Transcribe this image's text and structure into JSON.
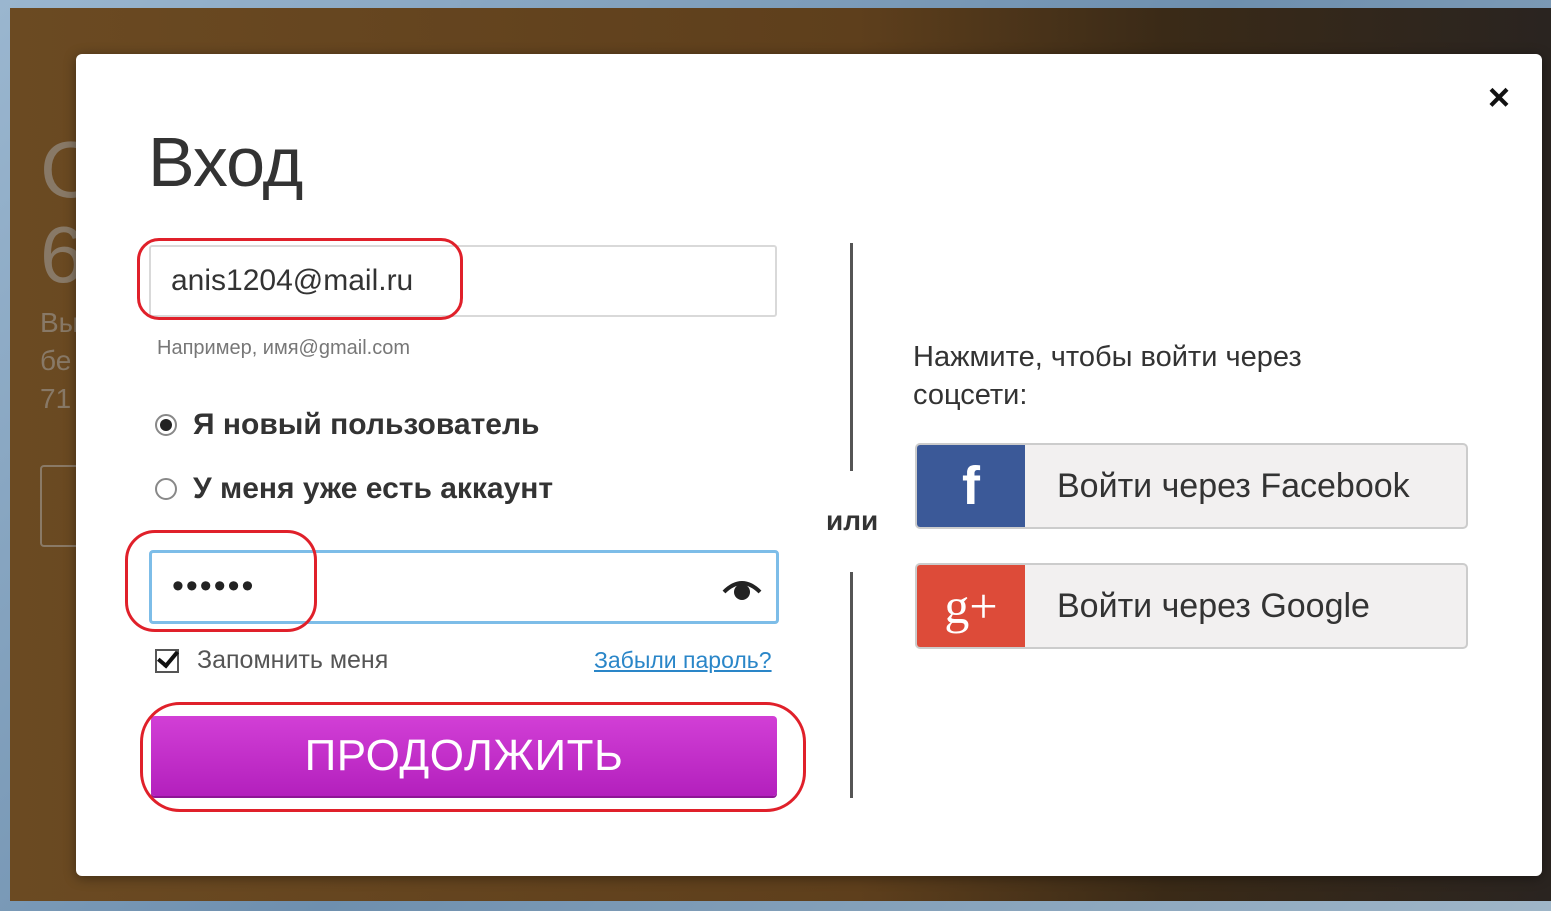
{
  "background": {
    "peek_big_1": "C",
    "peek_big_2": "6",
    "peek_small_1": "Вы",
    "peek_small_2": "бе",
    "peek_small_3": "71"
  },
  "modal": {
    "title": "Вход",
    "close_label": "×",
    "email": {
      "value": "anis1204@mail.ru",
      "hint": "Например, имя@gmail.com"
    },
    "radios": [
      {
        "label": "Я новый пользователь",
        "checked": true
      },
      {
        "label": "У меня уже есть аккаунт",
        "checked": false
      }
    ],
    "password": {
      "value": "••••••"
    },
    "remember_label": "Запомнить меня",
    "forgot_label": "Забыли пароль?",
    "continue_label": "ПРОДОЛЖИТЬ",
    "or_label": "или",
    "social": {
      "hint": "Нажмите, чтобы войти через соцсети:",
      "facebook": {
        "icon_text": "f",
        "label": "Войти через Facebook",
        "color": "#3b5998"
      },
      "google": {
        "icon_text": "g+",
        "label": "Войти через Google",
        "color": "#dd4b39"
      }
    },
    "accent_color": "#c030c8",
    "annotation_color": "#e0202a"
  }
}
